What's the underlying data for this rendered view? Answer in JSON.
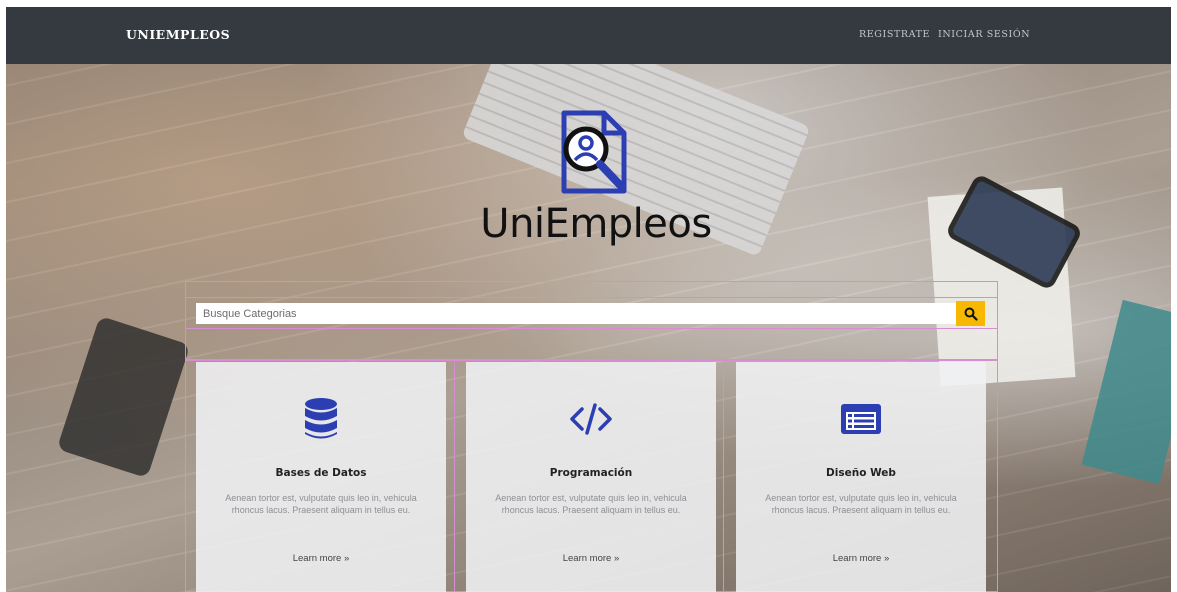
{
  "navbar": {
    "brand": "UNIEMPLEOS",
    "links": [
      "REGISTRATE",
      "INICIAR SESIÓN"
    ]
  },
  "logo": {
    "text": "UniEmpleos",
    "icon": "document-user-search-icon"
  },
  "search": {
    "placeholder": "Busque Categorias",
    "value": "",
    "button_icon": "search-icon"
  },
  "cards": [
    {
      "icon": "database-icon",
      "title": "Bases de Datos",
      "text": "Aenean tortor est, vulputate quis leo in, vehicula rhoncus lacus. Praesent aliquam in tellus eu.",
      "link": "Learn more »"
    },
    {
      "icon": "code-icon",
      "title": "Programación",
      "text": "Aenean tortor est, vulputate quis leo in, vehicula rhoncus lacus. Praesent aliquam in tellus eu.",
      "link": "Learn more »"
    },
    {
      "icon": "list-window-icon",
      "title": "Diseño Web",
      "text": "Aenean tortor est, vulputate quis leo in, vehicula rhoncus lacus. Praesent aliquam in tellus eu.",
      "link": "Learn more »"
    }
  ],
  "colors": {
    "navbar": "#343a40",
    "accent_blue": "#2b3fb3",
    "search_button": "#f6b800",
    "outline": "#d68ed1"
  }
}
